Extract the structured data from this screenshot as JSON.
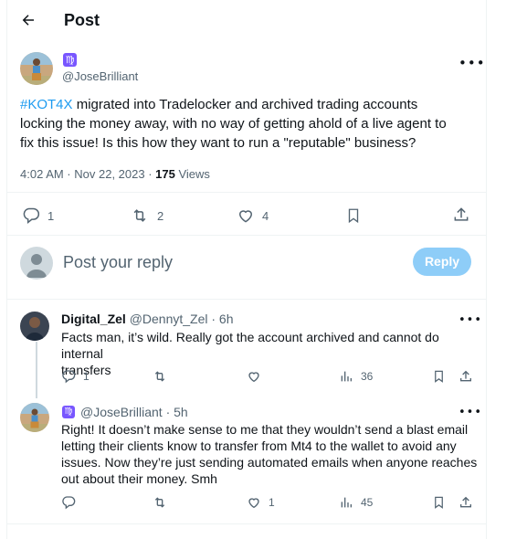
{
  "header": {
    "title": "Post"
  },
  "post": {
    "author_badge": "♍",
    "handle": "@JoseBrilliant",
    "hashtag": "#KOT4X",
    "text_lines": [
      " migrated into Tradelocker and archived trading accounts",
      "locking the money away, with no way of getting ahold of a live agent to",
      "fix this issue! Is this how they want to run a \"reputable\" business?"
    ],
    "timestamp": "4:02 AM · Nov 22, 2023 · ",
    "views_count": "175",
    "views_label": " Views",
    "stats": {
      "replies": "1",
      "reposts": "2",
      "likes": "4"
    }
  },
  "reply_box": {
    "placeholder": "Post your reply",
    "button_label": "Reply"
  },
  "replies": [
    {
      "name": "Digital_Zel",
      "handle": "@Dennyt_Zel · 6h",
      "text_lines": [
        "Facts man, it’s wild. Really got the account archived and cannot do internal",
        "transfers"
      ],
      "stats": {
        "replies": "1",
        "reposts": "",
        "likes": "",
        "views": "36"
      }
    },
    {
      "badge": "♍",
      "handle": "@JoseBrilliant · 5h",
      "text_lines": [
        "Right! It doesn’t make sense to me that they wouldn’t send a blast email",
        "letting their clients know to transfer from Mt4 to the wallet to avoid any",
        "issues. Now they’re just sending automated emails when anyone reaches",
        "out about their money. Smh"
      ],
      "stats": {
        "replies": "",
        "reposts": "",
        "likes": "1",
        "views": "45"
      }
    }
  ],
  "colors": {
    "accent": "#1d9bf0",
    "reply_button_disabled": "#8ecdf8",
    "badge_purple": "#7856ff",
    "text": "#0f1419",
    "muted": "#536471"
  }
}
